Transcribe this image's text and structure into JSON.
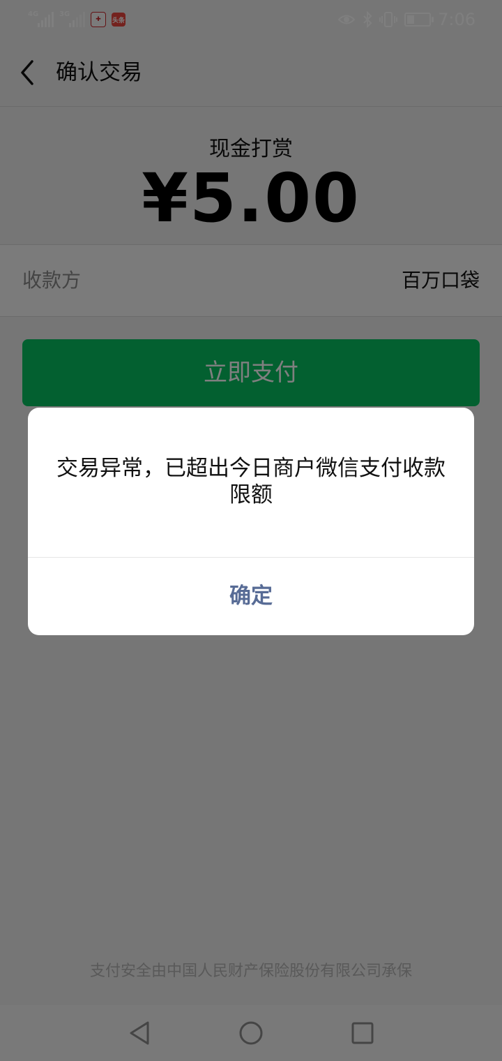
{
  "status_bar": {
    "network_1": "4G",
    "network_2": "3G",
    "time": "7:06",
    "icons": [
      "signal-4g-icon",
      "signal-3g-icon",
      "app-notification-icon",
      "toutiao-icon",
      "eye-icon",
      "bluetooth-icon",
      "vibrate-icon",
      "battery-icon"
    ],
    "app_icon_toutiao_text": "头条"
  },
  "nav": {
    "title": "确认交易",
    "back_icon": "chevron-left-icon"
  },
  "payment": {
    "type": "现金打赏",
    "amount": "¥5.00"
  },
  "payee": {
    "label": "收款方",
    "value": "百万口袋"
  },
  "pay_button": {
    "label": "立即支付"
  },
  "dialog": {
    "message": "交易异常，已超出今日商户微信支付收款限额",
    "confirm_label": "确定"
  },
  "footer": {
    "note": "支付安全由中国人民财产保险股份有限公司承保"
  },
  "system_nav": {
    "icons": [
      "back-triangle-icon",
      "home-circle-icon",
      "recents-square-icon"
    ]
  },
  "colors": {
    "accent_green": "#07c160",
    "link_blue": "#576b95",
    "mask": "rgba(0,0,0,0.5)"
  }
}
